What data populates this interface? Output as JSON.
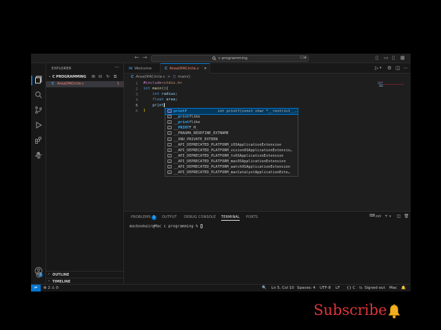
{
  "titlebar": {
    "search_text": "c programming",
    "back_icon": "arrow-left-icon",
    "forward_icon": "arrow-right-icon"
  },
  "sidebar": {
    "title": "EXPLORER",
    "folder_name": "C PROGRAMMING",
    "file_icon_text": "C",
    "file_name": "AreaOfACircle.c",
    "file_badge": "1",
    "outline_label": "OUTLINE",
    "timeline_label": "TIMELINE"
  },
  "tabs": [
    {
      "label": "Welcome",
      "icon": "vscode-icon"
    },
    {
      "label": "AreaOfACircle.c",
      "icon_text": "C",
      "active": true
    }
  ],
  "breadcrumb": {
    "icon_text": "C",
    "file": "AreaOfACircle.c",
    "separator": ">",
    "symbol": "main()"
  },
  "editor": {
    "lines": [
      {
        "n": "1",
        "text": "#include<stdio.h>"
      },
      {
        "n": "2",
        "text": "int main(){"
      },
      {
        "n": "3",
        "text": "    int radius;"
      },
      {
        "n": "4",
        "text": "    float area;"
      },
      {
        "n": "5",
        "text": "    print"
      },
      {
        "n": "6",
        "text": "}"
      }
    ],
    "tokens": {
      "include": "#include",
      "header": "<stdio.h>",
      "int": "int",
      "main": "main",
      "parens": "(){",
      "radius": "radius",
      "float": "float",
      "area": "area",
      "semicolon": ";",
      "print": "print",
      "close_brace": "}"
    }
  },
  "suggest": {
    "items": [
      {
        "label": "printf",
        "detail": "int printf(const char *__restrict__, ...)",
        "selected": true
      },
      {
        "label": "__printflike"
      },
      {
        "label": "__printflike"
      },
      {
        "label": "__PRINTF_H_"
      },
      {
        "label": "__PRAGMA_REDEFINE_EXTNAME"
      },
      {
        "label": "__XNU_PRIVATE_EXTERN"
      },
      {
        "label": "__API_DEPRECATED_PLATFORM_iOSApplicationExtension"
      },
      {
        "label": "__API_DEPRECATED_PLATFORM_visionOSApplicationExtensio…"
      },
      {
        "label": "__API_DEPRECATED_PLATFORM_tvOSApplicationExtension"
      },
      {
        "label": "__API_DEPRECATED_PLATFORM_macOSApplicationExtension"
      },
      {
        "label": "__API_DEPRECATED_PLATFORM_watchOSApplicationExtension"
      },
      {
        "label": "__API_DEPRECATED_PLATFORM_macCatalystApplicationExte…"
      }
    ]
  },
  "panel": {
    "tabs": [
      "PROBLEMS",
      "OUTPUT",
      "DEBUG CONSOLE",
      "TERMINAL",
      "PORTS"
    ],
    "problems_count": "1",
    "shell_label": "zsh",
    "terminal_line": "macbookair@Mac c programming % "
  },
  "statusbar": {
    "errors_warnings": "⊗ 2 ⚠ 0",
    "position": "Ln 5, Col 10",
    "spaces": "Spaces: 4",
    "encoding": "UTF-8",
    "eol": "LF",
    "language": "{} C",
    "signed_out": "Signed out",
    "platform": "Mac"
  },
  "overlay": {
    "subscribe_text": "Subscribe",
    "bell_icon": "bell-icon",
    "subscribe_color": "#e0343a"
  },
  "colors": {
    "accent": "#0078d4",
    "modified_file": "#f48771"
  }
}
